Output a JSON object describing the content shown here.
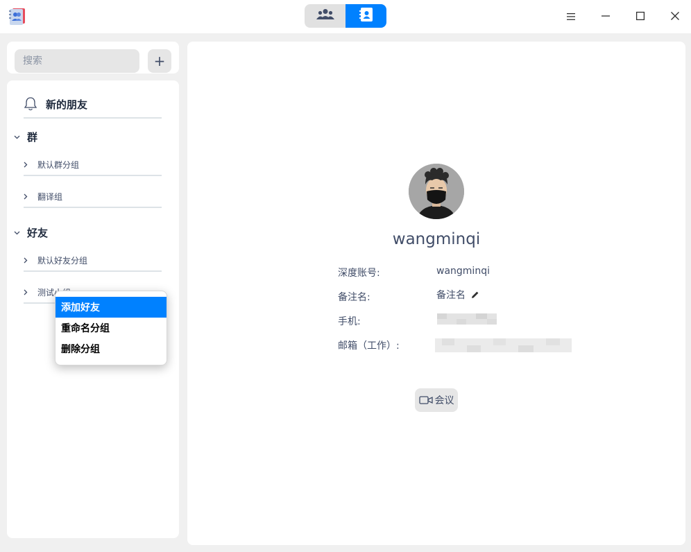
{
  "titlebar": {
    "app_icon": "contacts-app-icon",
    "view_switch": [
      {
        "icon": "group-people-icon",
        "active": false
      },
      {
        "icon": "contact-card-icon",
        "active": true
      }
    ],
    "window_buttons": [
      "menu-icon",
      "minimize-icon",
      "maximize-icon",
      "close-icon"
    ]
  },
  "search": {
    "placeholder": "搜索",
    "value": ""
  },
  "add_button": {
    "label": "+"
  },
  "sidebar": {
    "new_friends": {
      "icon": "bell-icon",
      "label": "新的朋友"
    },
    "sections": [
      {
        "title": "群",
        "expanded": true,
        "groups": [
          {
            "label": "默认群分组"
          },
          {
            "label": "翻译组"
          }
        ]
      },
      {
        "title": "好友",
        "expanded": true,
        "groups": [
          {
            "label": "默认好友分组"
          },
          {
            "label": "测试小组"
          }
        ]
      }
    ]
  },
  "context_menu": {
    "items": [
      {
        "label": "添加好友",
        "active": true
      },
      {
        "label": "重命名分组",
        "active": false
      },
      {
        "label": "删除分组",
        "active": false
      }
    ]
  },
  "profile": {
    "avatar_icon": "person-mask-avatar",
    "username": "wangminqi",
    "fields": [
      {
        "label": "深度账号:",
        "value": "wangminqi"
      },
      {
        "label": "备注名:",
        "value": "备注名",
        "editable": true
      },
      {
        "label": "手机:",
        "value": ""
      },
      {
        "label": "邮箱（工作）:",
        "value": ""
      }
    ],
    "meeting_button": {
      "icon": "video-camera-icon",
      "label": "会议"
    }
  },
  "colors": {
    "accent": "#0081ff",
    "panel": "#ffffff",
    "background": "#f0f0f0",
    "text": "#414d68"
  }
}
